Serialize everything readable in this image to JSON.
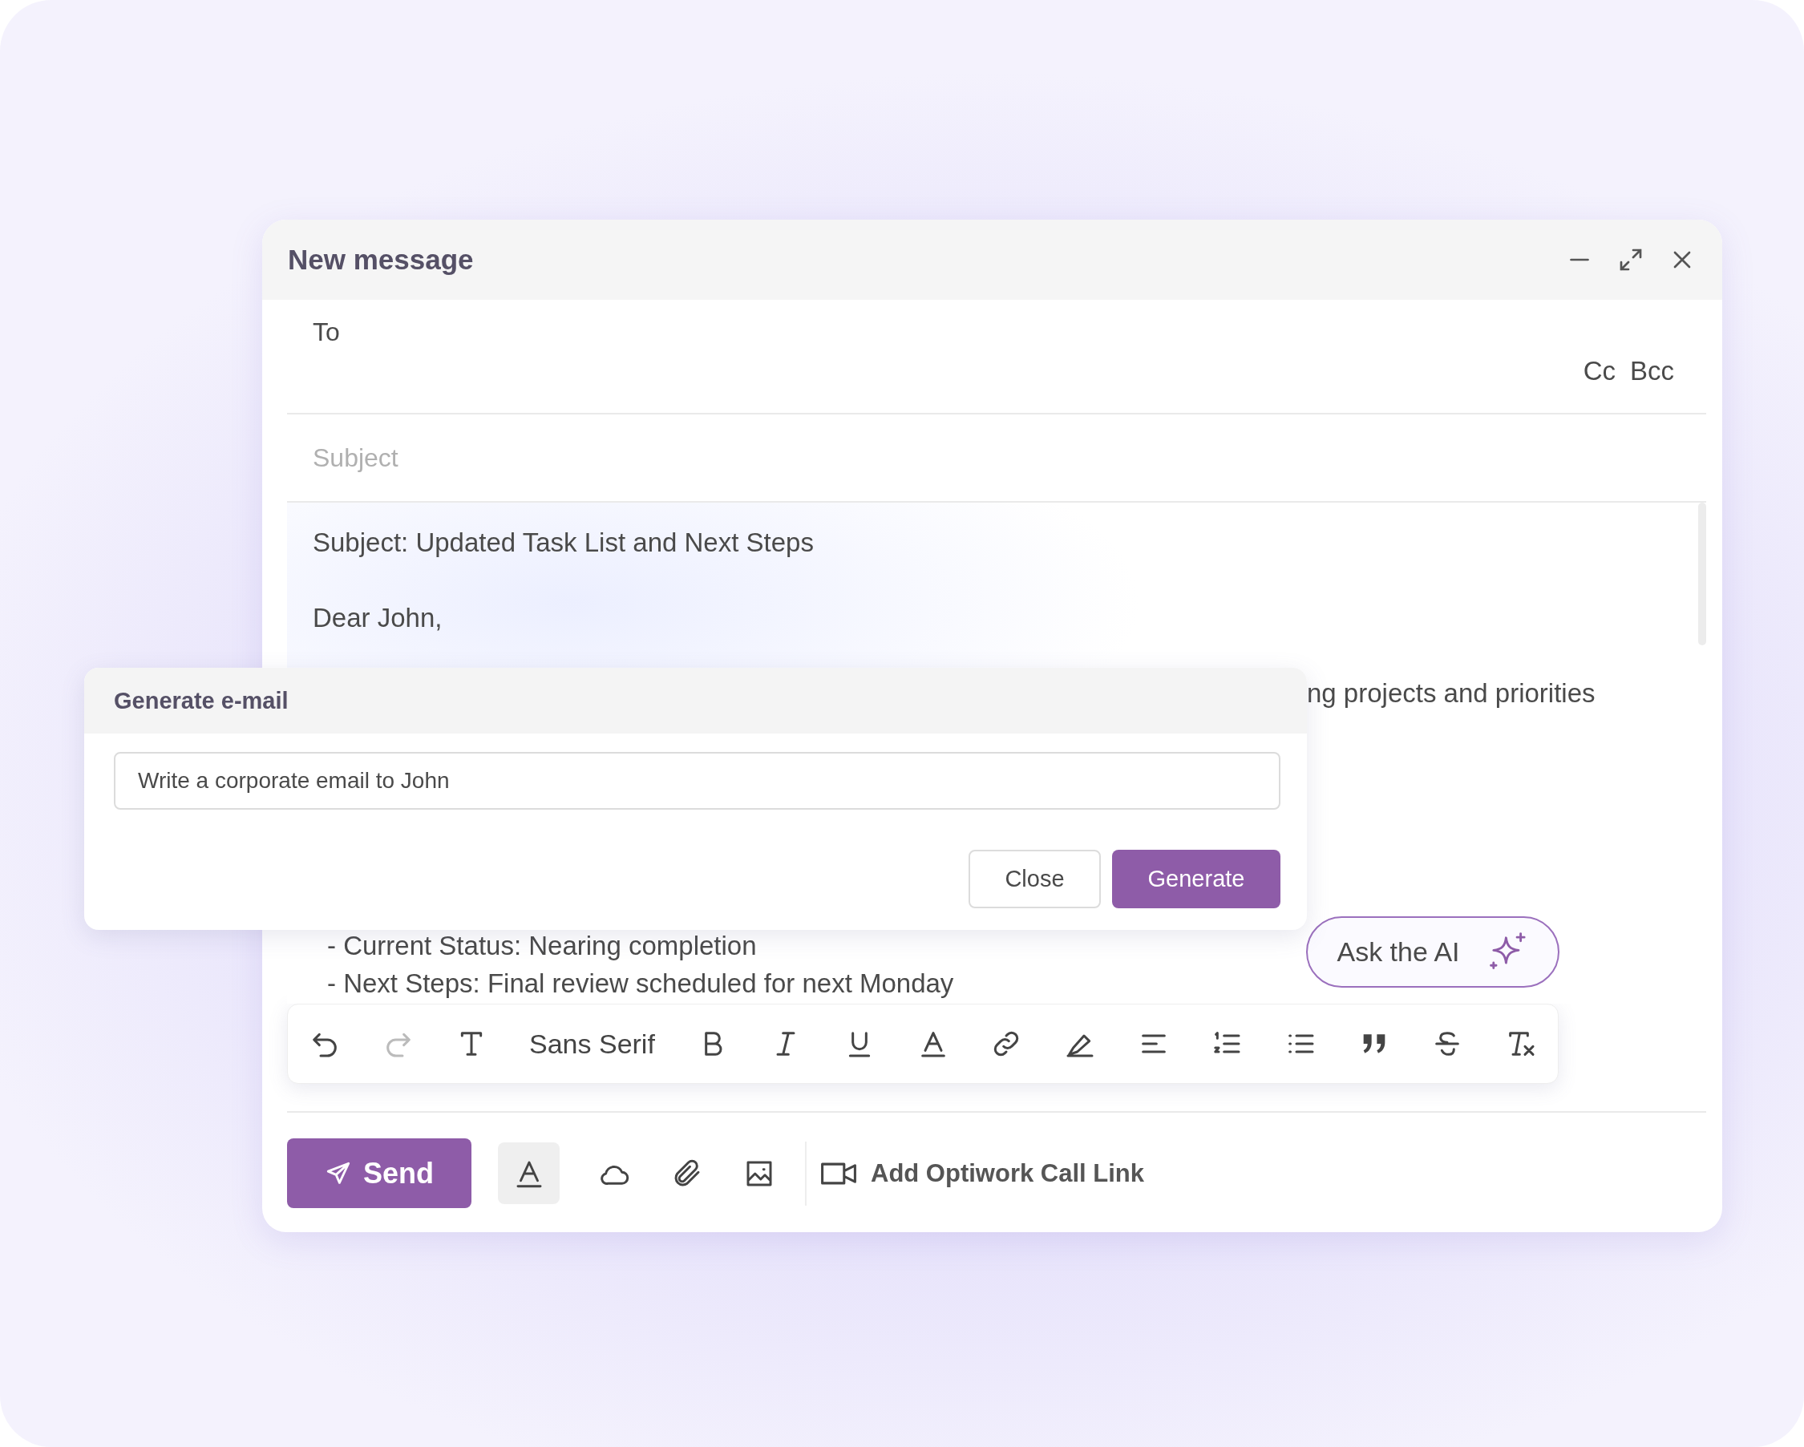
{
  "window": {
    "title": "New message"
  },
  "to": {
    "label": "To",
    "cc": "Cc",
    "bcc": "Bcc"
  },
  "subject": {
    "placeholder": "Subject"
  },
  "body": {
    "subject_line": "Subject: Updated Task List and Next Steps",
    "greeting": "Dear John,",
    "partial_line": "ng projects and priorities",
    "list_items": [
      "- Current Status: Nearing completion",
      "- Next Steps: Final review scheduled for next Monday"
    ]
  },
  "generate_dialog": {
    "title": "Generate e-mail",
    "prompt": "Write a corporate email to John",
    "buttons": {
      "close": "Close",
      "generate": "Generate"
    }
  },
  "ask_ai": {
    "label": "Ask the AI"
  },
  "toolbar": {
    "undo_disabled": false,
    "redo_disabled": true,
    "font": "Sans Serif"
  },
  "bottom_bar": {
    "send": "Send",
    "formatting_selected": true,
    "call_link": "Add Optiwork Call Link"
  }
}
